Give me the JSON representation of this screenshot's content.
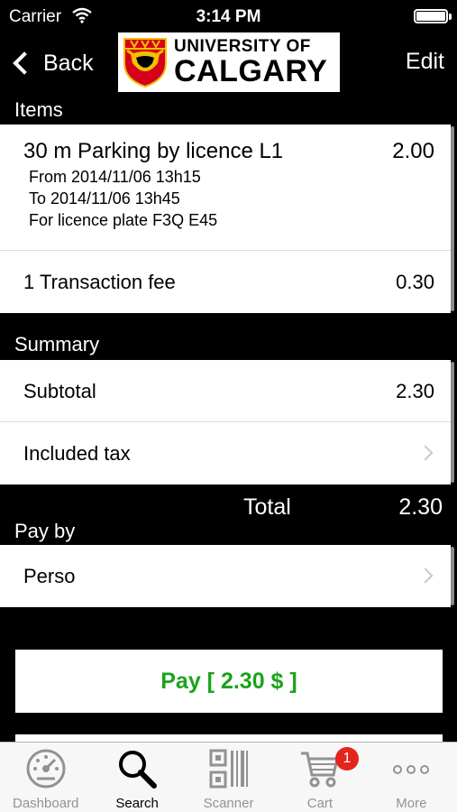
{
  "status_bar": {
    "carrier": "Carrier",
    "time": "3:14 PM"
  },
  "nav": {
    "back_label": "Back",
    "edit_label": "Edit",
    "logo_line1": "UNIVERSITY OF",
    "logo_line2": "CALGARY"
  },
  "items": {
    "header": "Items",
    "parking": {
      "title": "30 m Parking by licence L1",
      "price": "2.00",
      "from": "From 2014/11/06 13h15",
      "to": "To 2014/11/06 13h45",
      "plate": "For licence plate F3Q E45"
    },
    "fee": {
      "label": "1 Transaction fee",
      "value": "0.30"
    }
  },
  "summary": {
    "header": "Summary",
    "subtotal_label": "Subtotal",
    "subtotal_value": "2.30",
    "tax_label": "Included tax",
    "total_label": "Total",
    "total_value": "2.30"
  },
  "pay_by": {
    "header": "Pay by",
    "method": "Perso"
  },
  "pay_button": {
    "label": "Pay [ 2.30 $ ]",
    "color": "#1aa31a"
  },
  "tab_bar": {
    "tabs": [
      {
        "label": "Dashboard",
        "icon": "dashboard-gauge-icon"
      },
      {
        "label": "Search",
        "icon": "search-icon"
      },
      {
        "label": "Scanner",
        "icon": "barcode-scanner-icon"
      },
      {
        "label": "Cart",
        "icon": "cart-icon"
      },
      {
        "label": "More",
        "icon": "more-dots-icon"
      }
    ],
    "active": "Search",
    "cart_badge": "1"
  }
}
